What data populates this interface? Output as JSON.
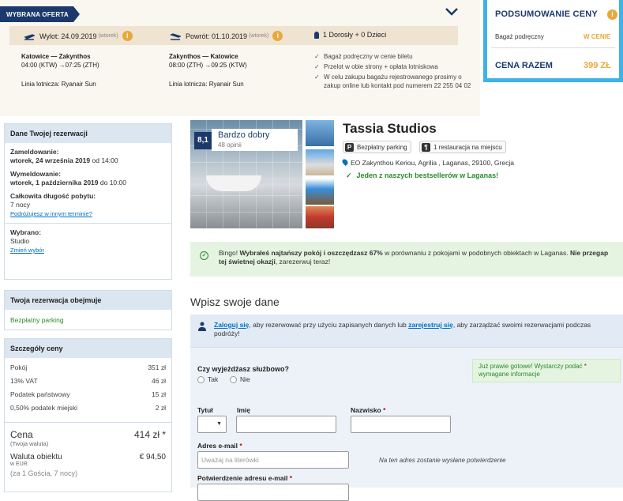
{
  "offer": {
    "badge": "WYBRANA OFERTA",
    "outbound": {
      "label": "Wylot: 24.09.2019",
      "day": "(wtorek)",
      "route": "Katowice — Zakynthos",
      "times": "04:00 (KTW) →07:25 (ZTH)",
      "airline": "Linia lotnicza: Ryanair Sun"
    },
    "return": {
      "label": "Powrót: 01.10.2019",
      "day": "(wtorek)",
      "route": "Zakynthos — Katowice",
      "times": "08:00 (ZTH) →09:25 (KTW)",
      "airline": "Linia lotnicza: Ryanair Sun"
    },
    "passengers": "1 Dorosły + 0 Dzieci",
    "inclusions": [
      "Bagaż podręczny w cenie biletu",
      "Przelot w obie strony + opłata lotniskowa",
      "W celu zakupu bagażu rejestrowanego prosimy o zakup online lub kontakt pod numerem 22 255 04 02"
    ]
  },
  "summary": {
    "title": "PODSUMOWANIE CENY",
    "bag_label": "Bagaż podręczny",
    "bag_value": "W CENIE",
    "total_label": "CENA RAZEM",
    "total_value": "399 ZŁ"
  },
  "reservation": {
    "title": "Dane Twojej rezerwacji",
    "checkin_label": "Zameldowanie:",
    "checkin_date": "wtorek, 24 września 2019",
    "checkin_time": "od 14:00",
    "checkout_label": "Wymeldowanie:",
    "checkout_date": "wtorek, 1 października 2019",
    "checkout_time": "do 10:00",
    "length_label": "Całkowita długość pobytu:",
    "length_value": "7 nocy",
    "other_dates_link": "Podróżujesz w innym terminie?",
    "chosen_label": "Wybrano:",
    "chosen_value": "Studio",
    "change_link": "Zmień wybór"
  },
  "includes": {
    "title": "Twoja rezerwacja obejmuje",
    "item": "Bezpłatny parking"
  },
  "price": {
    "title": "Szczegóły ceny",
    "rows": [
      {
        "label": "Pokój",
        "value": "351 zł"
      },
      {
        "label": "13% VAT",
        "value": "46 zł"
      },
      {
        "label": "Podatek państwowy",
        "value": "15 zł"
      },
      {
        "label": "0,50% podatek miejski",
        "value": "2 zł"
      }
    ],
    "total_label": "Cena",
    "total_sub": "(Twoja waluta)",
    "total_value": "414 zł *",
    "local_label": "Waluta obiektu",
    "local_sub": "w EUR",
    "local_value": "€ 94,50",
    "guests": "(za 1 Gościa, 7 nocy)"
  },
  "hotel": {
    "rating": "8,1",
    "rating_label": "Bardzo dobry",
    "rating_count": "48 opinii",
    "name": "Tassia Studios",
    "amenity_parking": "Bezpłatny parking",
    "amenity_restaurant": "1 restauracja na miejscu",
    "address": "EO Zakynthou Keriou, Agrilia , Laganas, 29100, Grecja",
    "bestseller": "Jeden z naszych bestsellerów w Laganas!"
  },
  "bingo": {
    "lead": "Bingo!",
    "bold": "Wybrałeś najtańszy pokój i oszczędzasz 67%",
    "mid": "w porównaniu z pokojami w podobnych obiektach w Laganas.",
    "bold2": "Nie przegap tej świetnej okazji",
    "end": ", zarezerwuj teraz!"
  },
  "form": {
    "title": "Wpisz swoje dane",
    "login_link": "Zaloguj się",
    "login_mid": ", aby rezerwować przy użyciu zapisanych danych lub",
    "register_link": "zarejestruj się",
    "login_end": ", aby zarządzać swoimi rezerwacjami podczas podróży!",
    "business_q": "Czy wyjeżdżasz służbowo?",
    "yes": "Tak",
    "no": "Nie",
    "almost": "Już prawie gotowe! Wystarczy podać",
    "almost2": "wymagane informacje",
    "title_label": "Tytuł",
    "first_label": "Imię",
    "last_label": "Nazwisko",
    "email_label": "Adres e-mail",
    "email_placeholder": "Uważaj na literówki",
    "email_note": "Na ten adres zostanie wysłane potwierdzenie",
    "confirm_label": "Potwierdzenie adresu e-mail"
  }
}
